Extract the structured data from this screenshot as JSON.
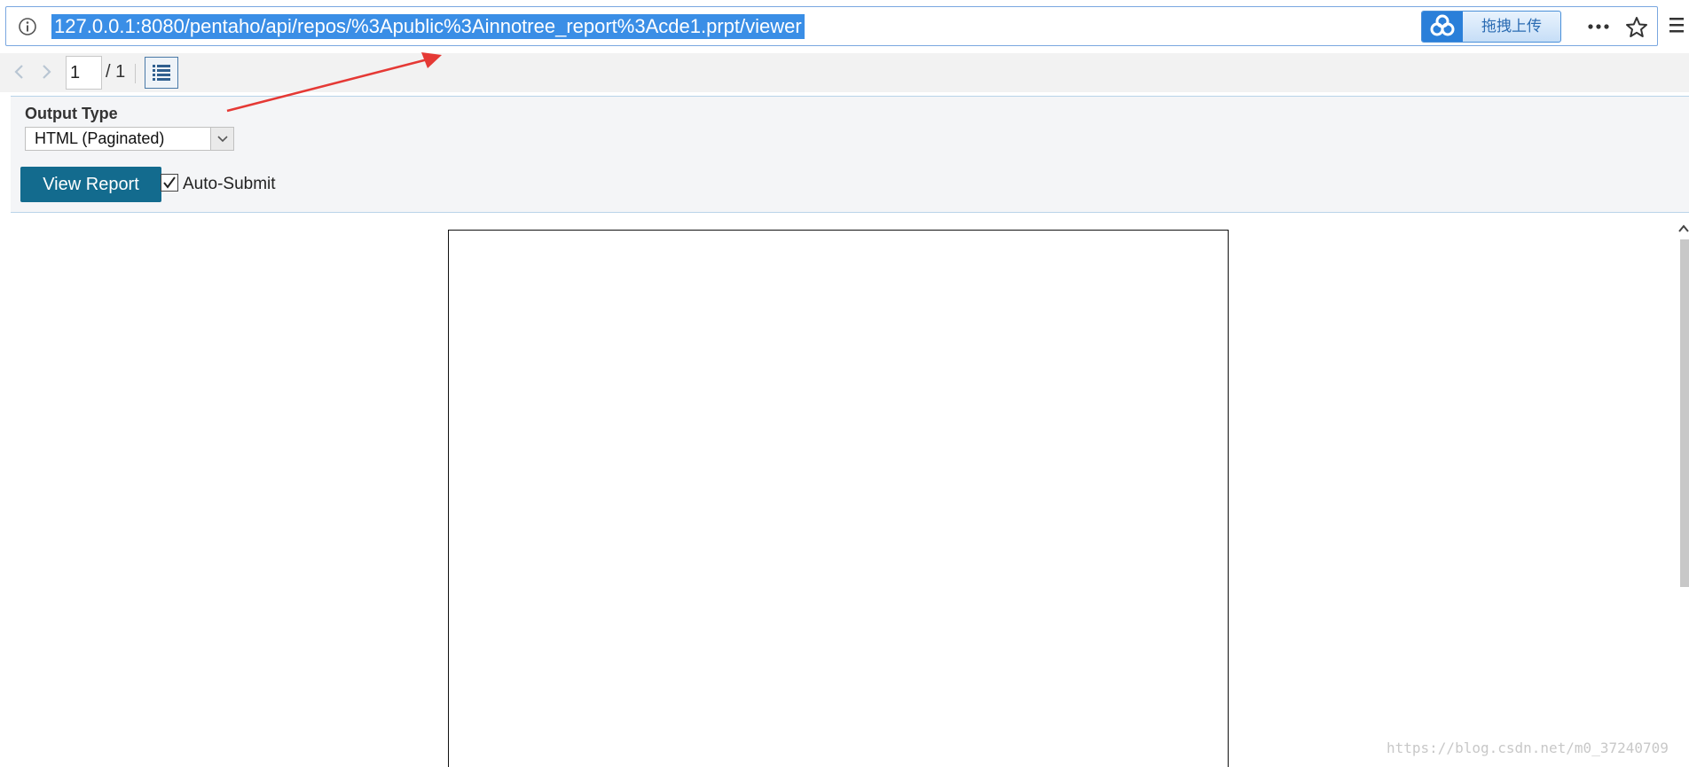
{
  "browser": {
    "url": "127.0.0.1:8080/pentaho/api/repos/%3Apublic%3Ainnotree_report%3Acde1.prpt/viewer",
    "upload_button_label": "拖拽上传",
    "icons": [
      "info-icon",
      "baidu-cloud-icon",
      "more-icon",
      "star-icon",
      "menu-icon"
    ]
  },
  "viewer_toolbar": {
    "page_value": "1",
    "page_total": "/ 1",
    "icons": [
      "chevron-left-icon",
      "chevron-right-icon",
      "list-icon"
    ]
  },
  "parameters": {
    "output_type_label": "Output Type",
    "output_type_value": "HTML (Paginated)",
    "view_report_label": "View Report",
    "auto_submit_checked": true,
    "auto_submit_label": "Auto-Submit"
  },
  "colors": {
    "url_highlight": "#3a8ee6",
    "view_report_button": "#136b8e",
    "annotation_arrow": "#e53935"
  },
  "watermark": "https://blog.csdn.net/m0_37240709"
}
